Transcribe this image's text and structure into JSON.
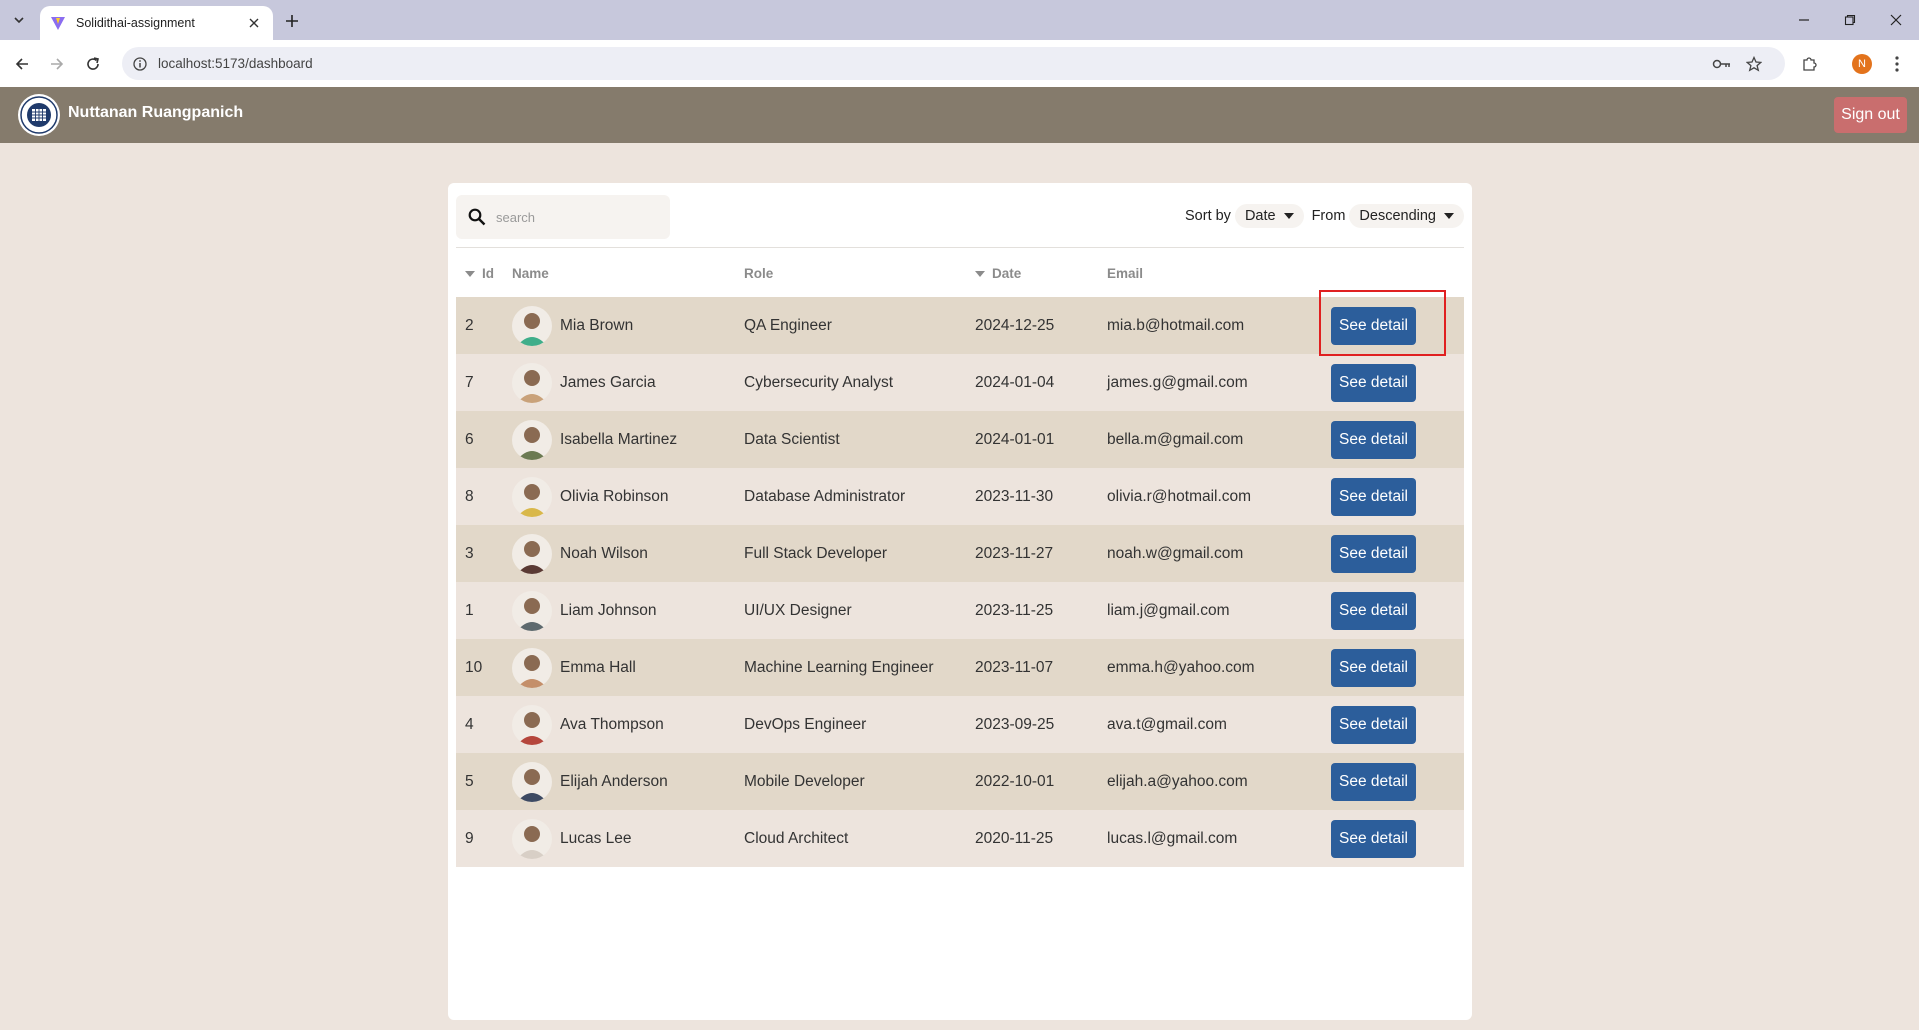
{
  "browser": {
    "tab_title": "Solidithai-assignment",
    "url": "localhost:5173/dashboard",
    "profile_initial": "N"
  },
  "header": {
    "user_name": "Nuttanan Ruangpanich",
    "signout_label": "Sign out"
  },
  "controls": {
    "search_placeholder": "search",
    "sort_by_label": "Sort by",
    "sort_value": "Date",
    "from_label": "From",
    "order_value": "Descending"
  },
  "table": {
    "columns": [
      "Id",
      "Name",
      "Role",
      "Date",
      "Email"
    ],
    "action_label": "See detail",
    "rows": [
      {
        "id": "2",
        "name": "Mia Brown",
        "role": "QA Engineer",
        "date": "2024-12-25",
        "email": "mia.b@hotmail.com",
        "avatar_color": "#3fae8a"
      },
      {
        "id": "7",
        "name": "James Garcia",
        "role": "Cybersecurity Analyst",
        "date": "2024-01-04",
        "email": "james.g@gmail.com",
        "avatar_color": "#c9a27a"
      },
      {
        "id": "6",
        "name": "Isabella Martinez",
        "role": "Data Scientist",
        "date": "2024-01-01",
        "email": "bella.m@gmail.com",
        "avatar_color": "#6b7a52"
      },
      {
        "id": "8",
        "name": "Olivia Robinson",
        "role": "Database Administrator",
        "date": "2023-11-30",
        "email": "olivia.r@hotmail.com",
        "avatar_color": "#d9b84a"
      },
      {
        "id": "3",
        "name": "Noah Wilson",
        "role": "Full Stack Developer",
        "date": "2023-11-27",
        "email": "noah.w@gmail.com",
        "avatar_color": "#5a3a34"
      },
      {
        "id": "1",
        "name": "Liam Johnson",
        "role": "UI/UX Designer",
        "date": "2023-11-25",
        "email": "liam.j@gmail.com",
        "avatar_color": "#5e6a6e"
      },
      {
        "id": "10",
        "name": "Emma Hall",
        "role": "Machine Learning Engineer",
        "date": "2023-11-07",
        "email": "emma.h@yahoo.com",
        "avatar_color": "#c48f6a"
      },
      {
        "id": "4",
        "name": "Ava Thompson",
        "role": "DevOps Engineer",
        "date": "2023-09-25",
        "email": "ava.t@gmail.com",
        "avatar_color": "#b5463c"
      },
      {
        "id": "5",
        "name": "Elijah Anderson",
        "role": "Mobile Developer",
        "date": "2022-10-01",
        "email": "elijah.a@yahoo.com",
        "avatar_color": "#3d4a63"
      },
      {
        "id": "9",
        "name": "Lucas Lee",
        "role": "Cloud Architect",
        "date": "2020-11-25",
        "email": "lucas.l@gmail.com",
        "avatar_color": "#d8cfc6"
      }
    ]
  },
  "colors": {
    "header_bg": "#857b6c",
    "signout_bg": "#c96e6e",
    "button_blue": "#2c5e9b",
    "row_odd": "#e2d8c9",
    "row_even": "#ede4dd"
  }
}
